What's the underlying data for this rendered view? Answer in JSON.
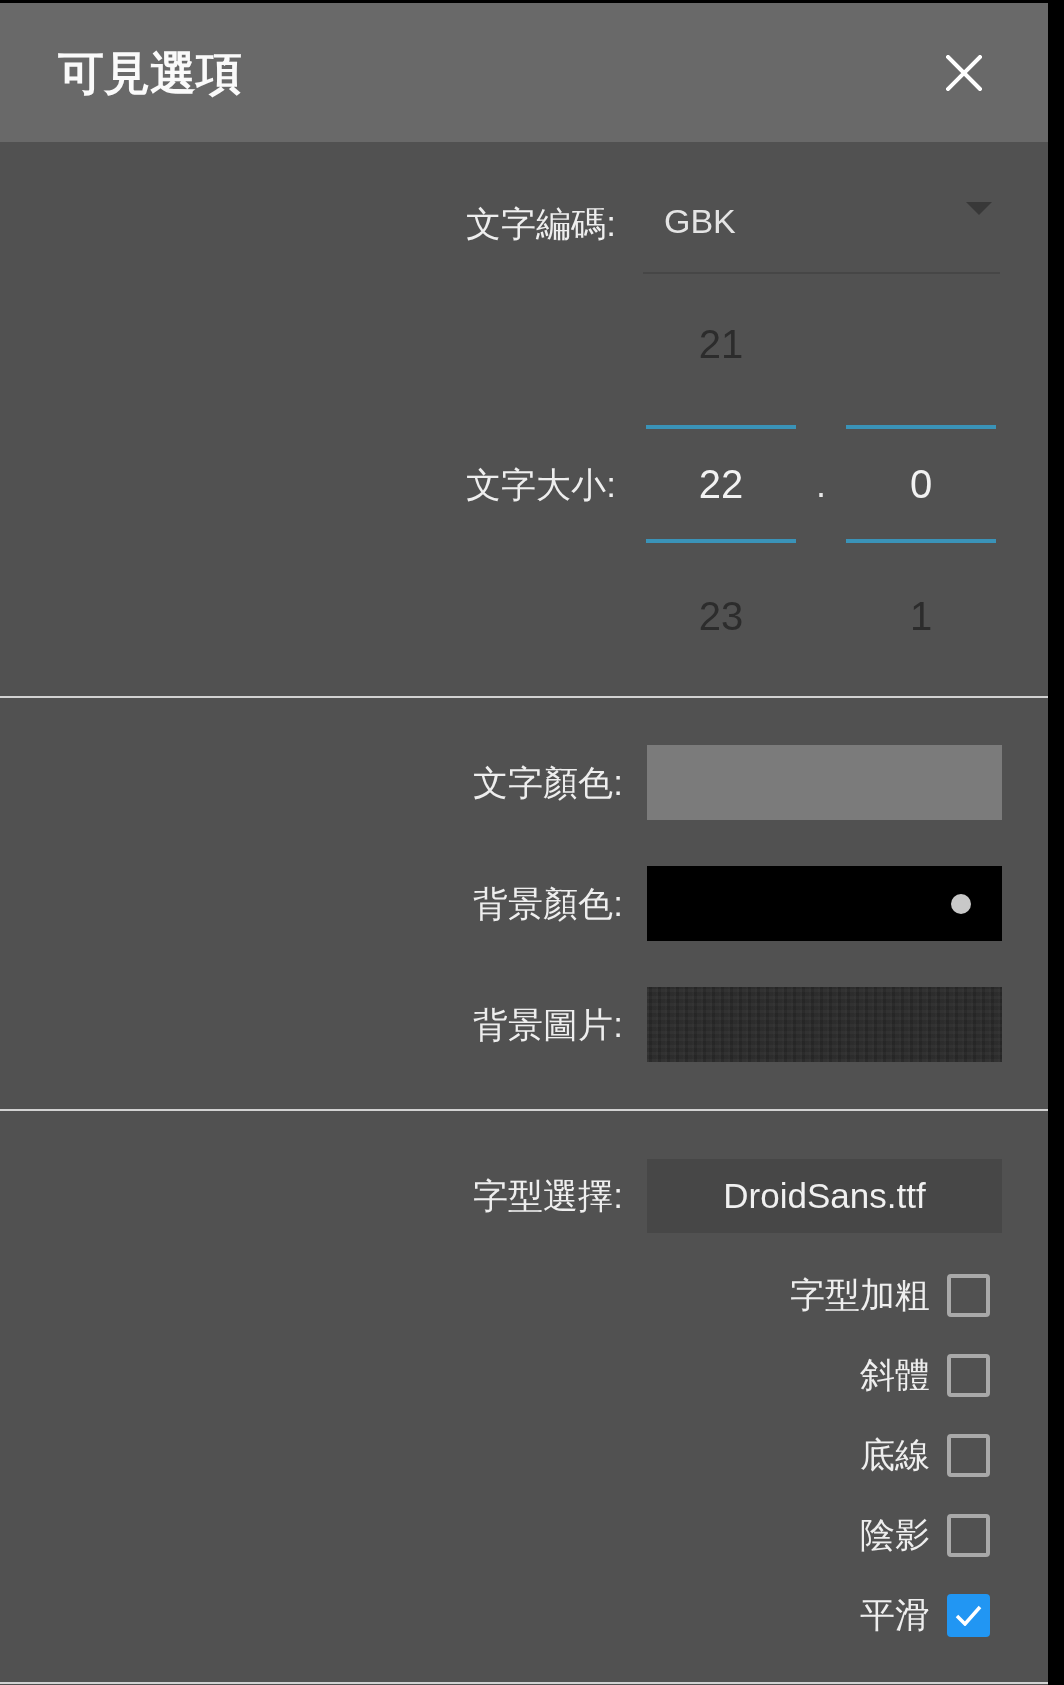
{
  "dialog": {
    "title": "可見選項"
  },
  "encoding": {
    "label": "文字編碼:",
    "value": "GBK"
  },
  "text_size": {
    "label": "文字大小:",
    "separator": ".",
    "columns": [
      {
        "previous": "21",
        "value": "22",
        "next": "23"
      },
      {
        "value": "0",
        "next": "1"
      }
    ]
  },
  "colors": [
    {
      "label": "文字顏色:",
      "kind": "color",
      "color": "#7b7b7b",
      "dot": false
    },
    {
      "label": "背景顏色:",
      "kind": "color",
      "color": "#000000",
      "dot": true
    },
    {
      "label": "背景圖片:",
      "kind": "image"
    }
  ],
  "font": {
    "label": "字型選擇:",
    "value": "DroidSans.ttf"
  },
  "options": [
    {
      "label": "字型加粗",
      "checked": false
    },
    {
      "label": "斜體",
      "checked": false
    },
    {
      "label": "底線",
      "checked": false
    },
    {
      "label": "陰影",
      "checked": false
    },
    {
      "label": "平滑",
      "checked": true
    }
  ]
}
